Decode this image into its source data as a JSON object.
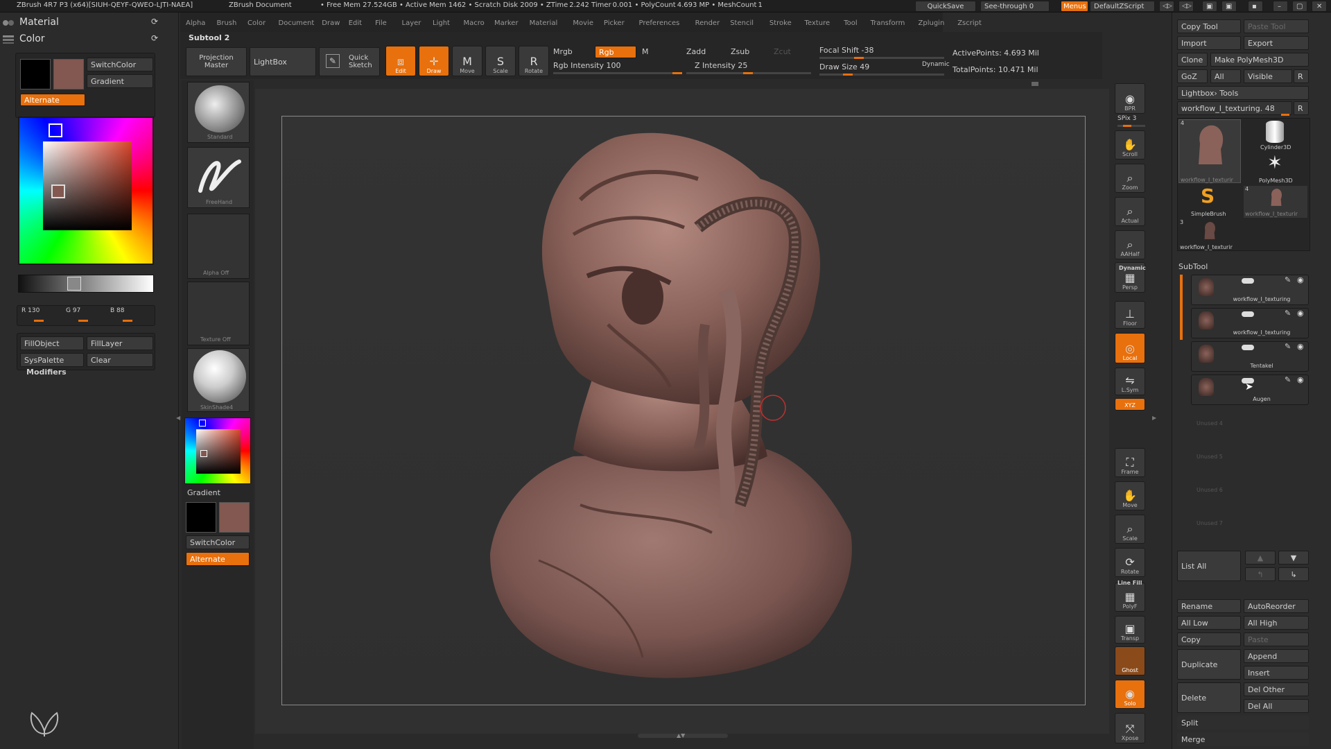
{
  "titlebar": {
    "app": "ZBrush 4R7 P3 (x64)[SIUH-QEYF-QWEO-LJTI-NAEA]",
    "document": "ZBrush Document",
    "status": "• Free Mem 27.524GB • Active Mem 1462 • Scratch Disk 2009 • ZTime 2.242 Timer 0.001 • PolyCount 4.693 MP • MeshCount 1",
    "quicksave": "QuickSave",
    "seethrough": "See-through  0",
    "menus": "Menus",
    "defaultzscript": "DefaultZScript"
  },
  "menu": [
    "Alpha",
    "Brush",
    "Color",
    "Document",
    "Draw",
    "Edit",
    "File",
    "Layer",
    "Light",
    "Macro",
    "Marker",
    "Material",
    "Movie",
    "Picker",
    "Preferences",
    "Render",
    "Stencil",
    "Stroke",
    "Texture",
    "Tool",
    "Transform",
    "Zplugin",
    "Zscript"
  ],
  "left": {
    "material": "Material",
    "color": "Color",
    "switchcolor": "SwitchColor",
    "gradient": "Gradient",
    "alternate": "Alternate",
    "r": "R 130",
    "g": "G 97",
    "b": "B 88",
    "fillobject": "FillObject",
    "filllayer": "FillLayer",
    "syspalette": "SysPalette",
    "clear": "Clear",
    "modifiers": "Modifiers",
    "main_color": "#825850"
  },
  "shelf": {
    "subtool_label": "Subtool 2",
    "projection_master": "Projection Master",
    "lightbox": "LightBox",
    "quick_sketch": "Quick Sketch",
    "edit": "Edit",
    "draw": "Draw",
    "move": "Move",
    "scale": "Scale",
    "rotate": "Rotate",
    "mrgb": "Mrgb",
    "rgb": "Rgb",
    "m": "M",
    "rgb_intensity": "Rgb Intensity 100",
    "zadd": "Zadd",
    "zsub": "Zsub",
    "zcut": "Zcut",
    "z_intensity": "Z Intensity 25",
    "focal_shift": "Focal Shift -38",
    "draw_size": "Draw Size 49",
    "dynamic": "Dynamic",
    "active_points": "ActivePoints: 4.693  Mil",
    "total_points": "TotalPoints: 10.471  Mil"
  },
  "brushcol": {
    "standard": "Standard",
    "freehand": "FreeHand",
    "alpha_off": "Alpha  Off",
    "texture_off": "Texture  Off",
    "skinshade": "SkinShade4",
    "gradient": "Gradient",
    "switchcolor": "SwitchColor",
    "alternate": "Alternate"
  },
  "righttools": [
    {
      "name": "bpr",
      "label": "BPR",
      "icon": "◉"
    },
    {
      "name": "scroll",
      "label": "Scroll",
      "icon": "✋"
    },
    {
      "name": "zoom",
      "label": "Zoom",
      "icon": "⌕"
    },
    {
      "name": "actual",
      "label": "Actual",
      "icon": "⌕"
    },
    {
      "name": "aahalf",
      "label": "AAHalf",
      "icon": "⌕"
    },
    {
      "name": "persp",
      "label": "Persp",
      "icon": "▦"
    },
    {
      "name": "floor",
      "label": "Floor",
      "icon": "⊥"
    },
    {
      "name": "local",
      "label": "Local",
      "icon": "◎"
    },
    {
      "name": "lsym",
      "label": "L.Sym",
      "icon": "⇋"
    },
    {
      "name": "xyz",
      "label": "XYZ",
      "icon": ""
    },
    {
      "name": "frame",
      "label": "Frame",
      "icon": "⛶"
    },
    {
      "name": "move",
      "label": "Move",
      "icon": "✋"
    },
    {
      "name": "scale",
      "label": "Scale",
      "icon": "⌕"
    },
    {
      "name": "rotate",
      "label": "Rotate",
      "icon": "⟳"
    },
    {
      "name": "polyf",
      "label": "PolyF",
      "icon": "▦"
    },
    {
      "name": "transp",
      "label": "Transp",
      "icon": "▣"
    },
    {
      "name": "ghost",
      "label": "Ghost",
      "icon": ""
    },
    {
      "name": "solo",
      "label": "Solo",
      "icon": "◉"
    },
    {
      "name": "xpose",
      "label": "Xpose",
      "icon": "⤧"
    }
  ],
  "spix": "SPix 3",
  "linefill": "Line Fill",
  "dynamic_label": "Dynamic",
  "right": {
    "copy_tool": "Copy Tool",
    "paste_tool": "Paste Tool",
    "import": "Import",
    "export": "Export",
    "clone": "Clone",
    "make_polymesh": "Make PolyMesh3D",
    "goz": "GoZ",
    "all": "All",
    "visible": "Visible",
    "r": "R",
    "lightbox_tools": "Lightbox› Tools",
    "current_tool": "workflow_I_texturing. 48",
    "tools": [
      "workflow_I_texturir",
      "Cylinder3D",
      "PolyMesh3D",
      "SimpleBrush",
      "workflow_I_texturir",
      "workflow_I_texturir"
    ],
    "tool_counts": [
      "4",
      "4",
      "3"
    ],
    "subtool_header": "SubTool",
    "subtools": [
      "workflow_I_texturing",
      "workflow_I_texturing",
      "Tentakel",
      "Augen"
    ],
    "unused": [
      "Unused 4",
      "Unused 5",
      "Unused 6",
      "Unused 7"
    ],
    "list_all": "List  All",
    "rename": "Rename",
    "autoreorder": "AutoReorder",
    "all_low": "All Low",
    "all_high": "All High",
    "copy": "Copy",
    "paste": "Paste",
    "duplicate": "Duplicate",
    "append": "Append",
    "insert": "Insert",
    "delete": "Delete",
    "del_other": "Del Other",
    "del_all": "Del All",
    "split": "Split",
    "merge": "Merge"
  }
}
